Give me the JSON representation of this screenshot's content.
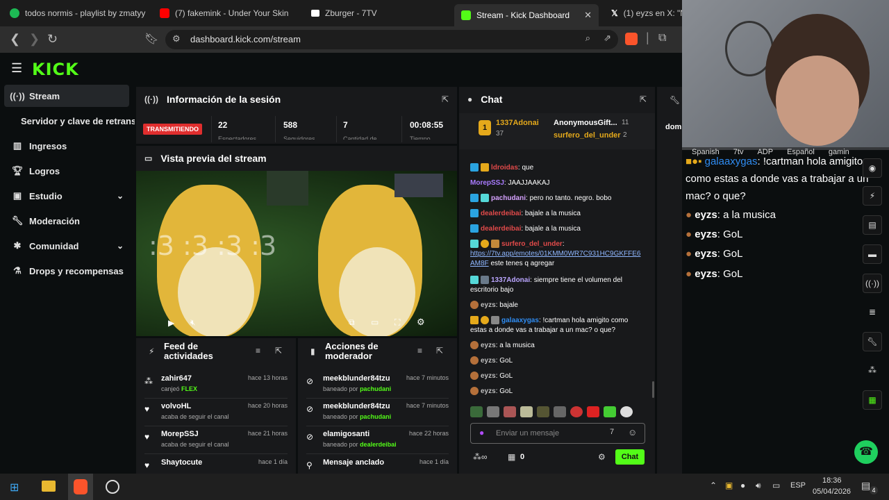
{
  "browser": {
    "tabs": [
      {
        "title": "todos normis - playlist by zmatyy"
      },
      {
        "title": "(7) fakemink - Under Your Skin"
      },
      {
        "title": "Zburger - 7TV"
      },
      {
        "title": "Stream - Kick Dashboard"
      },
      {
        "title": "(1) eyzs en X: \"N"
      }
    ],
    "url": "dashboard.kick.com/stream"
  },
  "sidebar": {
    "items": [
      {
        "label": "Stream",
        "icon": "broadcast-icon"
      },
      {
        "label": "Servidor y clave de retransmisión"
      },
      {
        "label": "Ingresos",
        "icon": "chart-icon"
      },
      {
        "label": "Logros",
        "icon": "trophy-icon"
      },
      {
        "label": "Estudio",
        "icon": "studio-icon"
      },
      {
        "label": "Moderación",
        "icon": "wrench-icon"
      },
      {
        "label": "Comunidad",
        "icon": "community-icon"
      },
      {
        "label": "Drops y recompensas",
        "icon": "drops-icon"
      }
    ]
  },
  "session": {
    "title": "Información de la sesión",
    "live_badge": "TRANSMITIENDO",
    "stats": [
      {
        "value": "22",
        "label": "Espectadores"
      },
      {
        "value": "588",
        "label": "Seguidores"
      },
      {
        "value": "7",
        "label": "Cantidad de"
      },
      {
        "value": "00:08:55",
        "label": "Tiempo"
      }
    ]
  },
  "preview": {
    "title": "Vista previa del stream",
    "overlay_text": ":3 :3 :3 :3"
  },
  "activity": {
    "title": "Feed de actividades",
    "items": [
      {
        "name": "zahir647",
        "sub": "canjeó",
        "highlight": "FLEX",
        "time": "hace 13 horas"
      },
      {
        "name": "volvoHL",
        "sub": "acaba de seguir el canal",
        "time": "hace 20 horas"
      },
      {
        "name": "MorepSSJ",
        "sub": "acaba de seguir el canal",
        "time": "hace 21 horas"
      },
      {
        "name": "Shaytocute",
        "sub": "",
        "time": "hace 1 día"
      }
    ]
  },
  "modactions": {
    "title": "Acciones de moderador",
    "items": [
      {
        "name": "meekblunder84tzu",
        "sub": "baneado por",
        "by": "pachudani",
        "time": "hace 7 minutos"
      },
      {
        "name": "meekblunder84tzu",
        "sub": "baneado por",
        "by": "pachudani",
        "time": "hace 7 minutos"
      },
      {
        "name": "elamigosanti",
        "sub": "baneado por",
        "by": "dealerdeibai",
        "time": "hace 22 horas"
      },
      {
        "name": "Mensaje anclado",
        "sub": "",
        "by": "",
        "time": "hace 1 día"
      }
    ]
  },
  "chat": {
    "title": "Chat",
    "top": [
      {
        "name": "1337Adonai",
        "count": "37"
      },
      {
        "name": "AnonymousGift...",
        "count": "11"
      },
      {
        "name": "surfero_del_under",
        "count": "2"
      }
    ],
    "messages": [
      {
        "user": "ldroidas",
        "text": ": que"
      },
      {
        "user": "MorepSSJ",
        "text": ": JAAJJAAKAJ"
      },
      {
        "user": "pachudani",
        "text": ": pero no tanto. negro. bobo"
      },
      {
        "user": "dealerdeibai",
        "text": ": bajale a la musica"
      },
      {
        "user": "dealerdeibai",
        "text": ": bajale a la musica"
      },
      {
        "user": "surfero_del_under",
        "text": ":",
        "link": "https://7tv.app/emotes/01KMM0WR7C931HC9GKFFE6AM8F",
        "after": "este tenes q agregar"
      },
      {
        "user": "1337Adonai",
        "text": ": siempre tiene el volumen del escritorio bajo"
      },
      {
        "user": "eyzs",
        "text": ": bajale"
      },
      {
        "user": "galaaxygas",
        "text": ": !cartman hola amigito como estas a donde vas a trabajar a un mac? o que?"
      },
      {
        "user": "eyzs",
        "text": ": a la musica"
      },
      {
        "user": "eyzs",
        "text": ": GoL"
      },
      {
        "user": "eyzs",
        "text": ": GoL"
      },
      {
        "user": "eyzs",
        "text": ": GoL"
      }
    ],
    "input_placeholder": "Enviar un mensaje",
    "count": "0",
    "send_label": "Chat"
  },
  "right_panel": {
    "label": "dom"
  },
  "overlay": {
    "tags": [
      "Spanish",
      "7tv",
      "ADP",
      "Español",
      "gamin"
    ],
    "messages": [
      {
        "user": "galaaxygas",
        "text": ": !cartman hola amigito como estas a donde vas a trabajar a un mac? o que?"
      },
      {
        "user": "eyzs",
        "text": ": a la musica"
      },
      {
        "user": "eyzs",
        "text": ": GoL"
      },
      {
        "user": "eyzs",
        "text": ": GoL"
      },
      {
        "user": "eyzs",
        "text": ": GoL"
      }
    ]
  },
  "taskbar": {
    "lang": "ESP",
    "time": "18:36",
    "date": "05/04/2026",
    "notif": "4"
  },
  "colors": {
    "kick_green": "#53fc18",
    "bg": "#0b0e0f",
    "panel": "#18191b",
    "live_red": "#e02e2e"
  }
}
